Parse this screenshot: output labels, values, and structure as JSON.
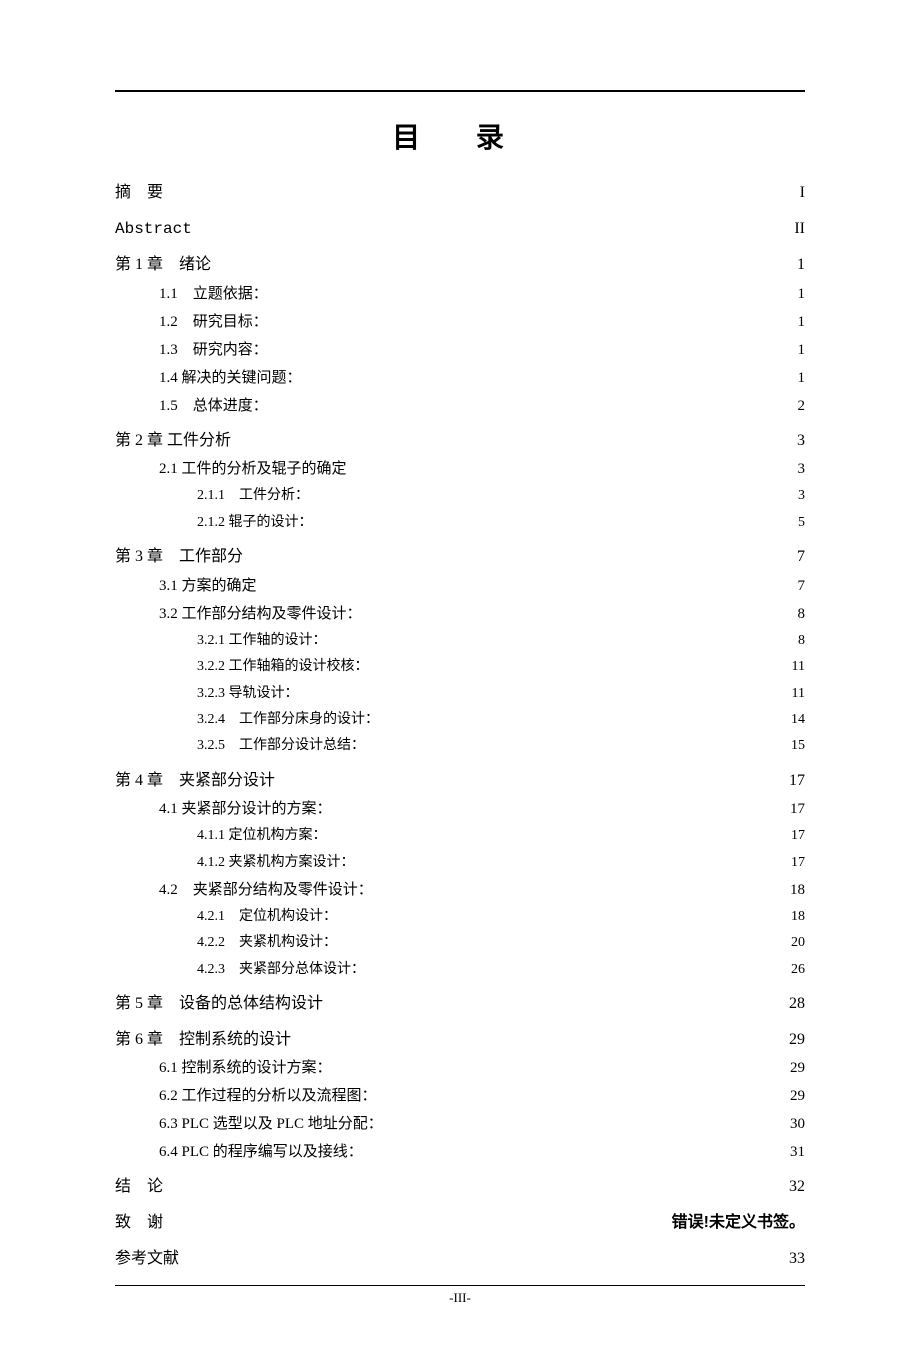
{
  "title": "目 录",
  "page_footer": "-III-",
  "entries": [
    {
      "level": 0,
      "label": "摘　要",
      "page": "I"
    },
    {
      "level": 0,
      "label": "Abstract",
      "page": "II",
      "style": "mono"
    },
    {
      "level": 0,
      "label": "第 1 章　绪论",
      "page": "1"
    },
    {
      "level": 1,
      "label": "1.1　立题依据：",
      "page": "1"
    },
    {
      "level": 1,
      "label": "1.2　研究目标：",
      "page": "1"
    },
    {
      "level": 1,
      "label": "1.3　研究内容：",
      "page": "1"
    },
    {
      "level": 1,
      "label": "1.4 解决的关键问题：",
      "page": "1"
    },
    {
      "level": 1,
      "label": "1.5　总体进度：",
      "page": "2"
    },
    {
      "level": 0,
      "label": "第 2 章 工件分析",
      "page": "3"
    },
    {
      "level": 1,
      "label": "2.1 工件的分析及辊子的确定",
      "page": "3"
    },
    {
      "level": 2,
      "label": "2.1.1　工件分析：",
      "page": "3"
    },
    {
      "level": 2,
      "label": "2.1.2 辊子的设计：",
      "page": "5"
    },
    {
      "level": 0,
      "label": "第 3 章　工作部分",
      "page": "7"
    },
    {
      "level": 1,
      "label": "3.1 方案的确定",
      "page": "7"
    },
    {
      "level": 1,
      "label": "3.2 工作部分结构及零件设计：",
      "page": "8"
    },
    {
      "level": 2,
      "label": "3.2.1 工作轴的设计：",
      "page": "8"
    },
    {
      "level": 2,
      "label": "3.2.2 工作轴箱的设计校核：",
      "page": "11"
    },
    {
      "level": 2,
      "label": "3.2.3 导轨设计：",
      "page": "11"
    },
    {
      "level": 2,
      "label": "3.2.4　工作部分床身的设计：",
      "page": "14"
    },
    {
      "level": 2,
      "label": "3.2.5　工作部分设计总结：",
      "page": "15"
    },
    {
      "level": 0,
      "label": "第 4 章　夹紧部分设计",
      "page": "17"
    },
    {
      "level": 1,
      "label": "4.1 夹紧部分设计的方案：",
      "page": "17"
    },
    {
      "level": 2,
      "label": "4.1.1 定位机构方案：",
      "page": "17"
    },
    {
      "level": 2,
      "label": "4.1.2 夹紧机构方案设计：",
      "page": "17"
    },
    {
      "level": 1,
      "label": "4.2　夹紧部分结构及零件设计：",
      "page": "18"
    },
    {
      "level": 2,
      "label": "4.2.1　定位机构设计：",
      "page": "18"
    },
    {
      "level": 2,
      "label": "4.2.2　夹紧机构设计：",
      "page": "20"
    },
    {
      "level": 2,
      "label": "4.2.3　夹紧部分总体设计：",
      "page": "26"
    },
    {
      "level": 0,
      "label": "第 5 章　设备的总体结构设计",
      "page": "28"
    },
    {
      "level": 0,
      "label": "第 6 章　控制系统的设计",
      "page": "29"
    },
    {
      "level": 1,
      "label": "6.1 控制系统的设计方案：",
      "page": "29"
    },
    {
      "level": 1,
      "label": "6.2 工作过程的分析以及流程图：",
      "page": "29"
    },
    {
      "level": 1,
      "label": "6.3 PLC 选型以及 PLC 地址分配：",
      "page": "30"
    },
    {
      "level": 1,
      "label": "6.4 PLC 的程序编写以及接线：",
      "page": "31"
    },
    {
      "level": 0,
      "label": "结　论",
      "page": "32"
    },
    {
      "level": 0,
      "label": "致　谢",
      "page": "错误!未定义书签。",
      "page_bold": true
    },
    {
      "level": 0,
      "label": "参考文献",
      "page": "33"
    }
  ]
}
